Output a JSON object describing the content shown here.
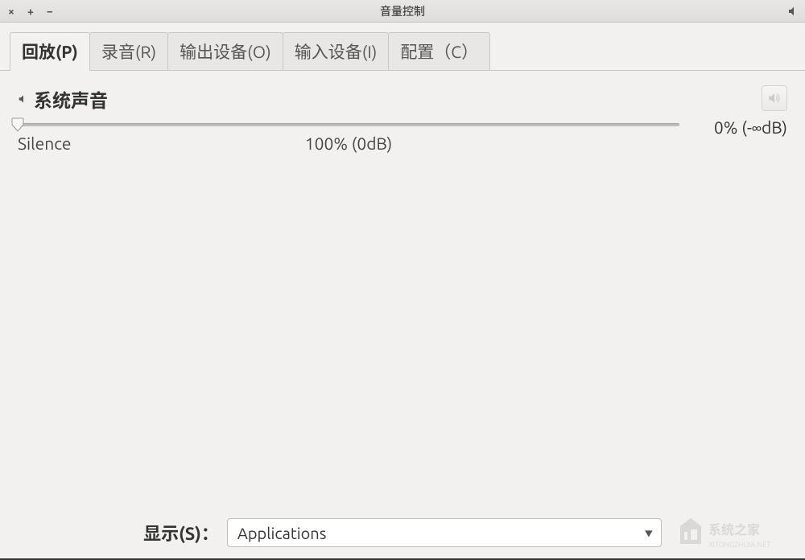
{
  "window": {
    "title": "音量控制"
  },
  "titlebar_controls": {
    "close": "×",
    "maximize": "+",
    "minimize": "−"
  },
  "tabs": [
    {
      "label": "回放(P)",
      "active": true
    },
    {
      "label": "录音(R)",
      "active": false
    },
    {
      "label": "输出设备(O)",
      "active": false
    },
    {
      "label": "输入设备(I)",
      "active": false
    },
    {
      "label": "配置（C）",
      "active": false
    }
  ],
  "stream": {
    "name": "系统声音",
    "slider": {
      "min_label": "Silence",
      "center_label": "100% (0dB)",
      "value_percent": 0
    },
    "readout": "0% (-∞dB)"
  },
  "bottom": {
    "show_label": "显示(S)：",
    "dropdown_value": "Applications"
  },
  "icons": {
    "speaker": "speaker-icon",
    "mute_speaker": "speaker-mute-icon"
  }
}
